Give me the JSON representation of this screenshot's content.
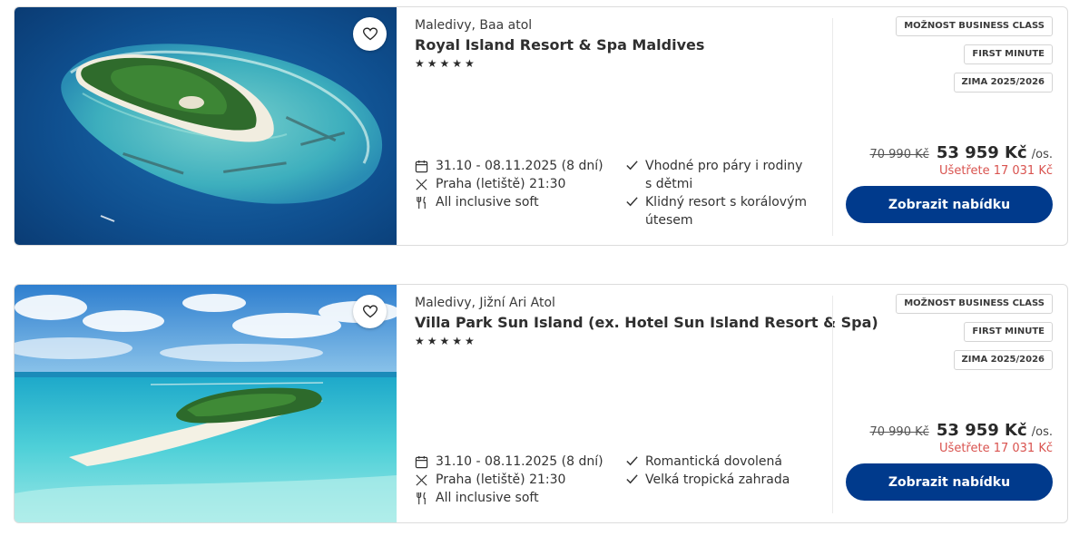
{
  "offers": [
    {
      "location": "Maledivy, Baa atol",
      "name": "Royal Island Resort & Spa Maldives",
      "stars": "★★★★★",
      "dates": "31.10 - 08.11.2025 (8 dní)",
      "departure": "Praha (letiště) 21:30",
      "board": "All inclusive soft",
      "features": [
        "Vhodné pro páry i rodiny s dětmi",
        "Klidný resort s korálovým útesem"
      ],
      "badges": [
        "MOŽNOST BUSINESS CLASS",
        "FIRST MINUTE",
        "ZIMA 2025/2026"
      ],
      "old_price": "70 990 Kč",
      "price": "53 959 Kč",
      "per": "/os.",
      "savings": "Ušetřete 17 031 Kč",
      "cta": "Zobrazit nabídku",
      "image": "aerial-island-atoll"
    },
    {
      "location": "Maledivy, Jižní Ari Atol",
      "name": "Villa Park Sun Island (ex. Hotel Sun Island Resort & Spa)",
      "stars": "★★★★★",
      "dates": "31.10 - 08.11.2025 (8 dní)",
      "departure": "Praha (letiště) 21:30",
      "board": "All inclusive soft",
      "features": [
        "Romantická dovolená",
        "Velká tropická zahrada"
      ],
      "badges": [
        "MOŽNOST BUSINESS CLASS",
        "FIRST MINUTE",
        "ZIMA 2025/2026"
      ],
      "old_price": "70 990 Kč",
      "price": "53 959 Kč",
      "per": "/os.",
      "savings": "Ušetřete 17 031 Kč",
      "cta": "Zobrazit nabídku",
      "image": "island-lagoon-sky"
    }
  ],
  "icons": {
    "favorite": "heart-icon",
    "dates": "calendar-icon",
    "departure": "plane-icon",
    "board": "cutlery-icon",
    "feature": "check-icon"
  },
  "colors": {
    "cta_background": "#003a8c",
    "cta_text": "#ffffff",
    "savings": "#d9534f",
    "border": "#dcdcdc"
  }
}
